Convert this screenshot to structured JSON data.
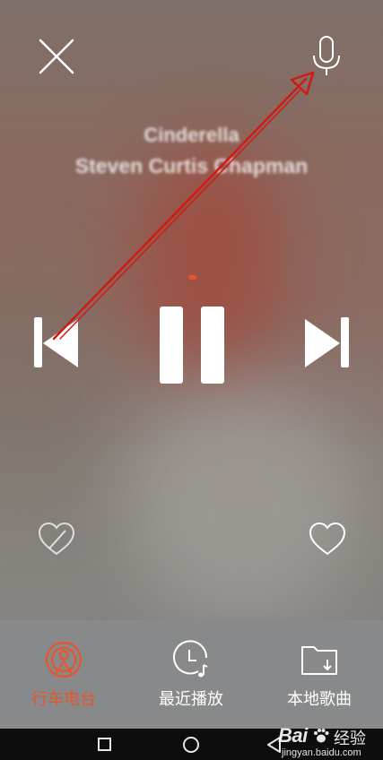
{
  "player": {
    "song_title": "Cinderella",
    "artist": "Steven Curtis Chapman",
    "progress": 0.0
  },
  "controls": {
    "close_icon": "close-icon",
    "mic_icon": "microphone-icon",
    "prev_icon": "previous-track-icon",
    "pause_icon": "pause-icon",
    "next_icon": "next-track-icon",
    "dislike_icon": "dislike-heart-icon",
    "like_icon": "heart-icon"
  },
  "bottom_nav": {
    "items": [
      {
        "label": "行车电台",
        "icon": "car-radio-icon",
        "active": true
      },
      {
        "label": "最近播放",
        "icon": "recent-clock-icon",
        "active": false
      },
      {
        "label": "本地歌曲",
        "icon": "local-folder-icon",
        "active": false
      }
    ]
  },
  "watermark": {
    "brand": "Bai",
    "name": "经验",
    "domain": "jingyan.baidu.com"
  },
  "colors": {
    "accent": "#e8542c",
    "icon": "#ffffff",
    "annotation_arrow": "#d11a14",
    "system_bar": "#0d0d0d"
  }
}
